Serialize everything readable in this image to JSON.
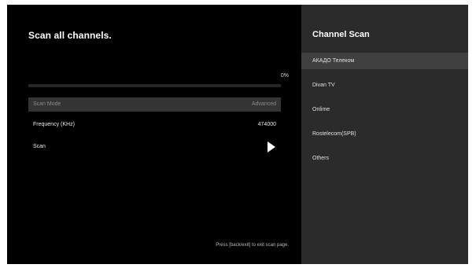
{
  "left_panel": {
    "title": "Scan all channels.",
    "progress": {
      "text": "0%",
      "value": 0
    },
    "rows": {
      "scan_mode": {
        "label": "Scan Mode",
        "value": "Advanced"
      },
      "frequency": {
        "label": "Frequency (KHz)",
        "value": "474000"
      },
      "scan": {
        "label": "Scan",
        "icon": "play-arrow-icon"
      }
    },
    "hint": "Press [back/exit] to exit scan page."
  },
  "right_panel": {
    "title": "Channel Scan",
    "operators": [
      {
        "label": "АКАДО Телеком",
        "focused": true
      },
      {
        "label": "Divan TV",
        "focused": false
      },
      {
        "label": "Onlime",
        "focused": false
      },
      {
        "label": "Rostelecom(SPB)",
        "focused": false
      },
      {
        "label": "Others",
        "focused": false
      }
    ]
  },
  "colors": {
    "background": "#000000",
    "panel_background": "#2b2b2b",
    "focused_row": "#404040",
    "disabled_row": "#343434",
    "text": "#ffffff"
  }
}
